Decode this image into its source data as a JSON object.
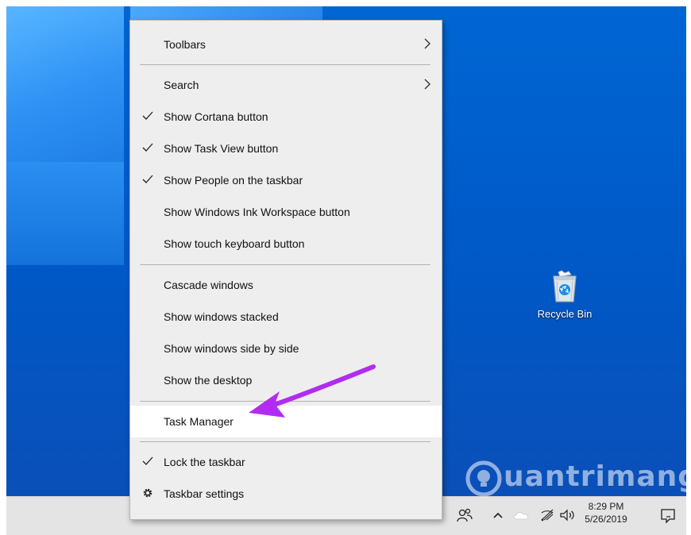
{
  "context_menu": {
    "items": [
      {
        "label": "Toolbars",
        "checked": false,
        "submenu": true
      },
      {
        "label": "Search",
        "checked": false,
        "submenu": true
      },
      {
        "label": "Show Cortana button",
        "checked": true
      },
      {
        "label": "Show Task View button",
        "checked": true
      },
      {
        "label": "Show People on the taskbar",
        "checked": true
      },
      {
        "label": "Show Windows Ink Workspace button",
        "checked": false
      },
      {
        "label": "Show touch keyboard button",
        "checked": false
      },
      {
        "label": "Cascade windows",
        "checked": false
      },
      {
        "label": "Show windows stacked",
        "checked": false
      },
      {
        "label": "Show windows side by side",
        "checked": false
      },
      {
        "label": "Show the desktop",
        "checked": false
      },
      {
        "label": "Task Manager",
        "checked": false,
        "highlighted": true
      },
      {
        "label": "Lock the taskbar",
        "checked": true
      },
      {
        "label": "Taskbar settings",
        "icon": "gear-icon"
      }
    ]
  },
  "desktop": {
    "recycle_bin_label": "Recycle Bin"
  },
  "taskbar": {
    "clock_time": "8:29 PM",
    "clock_date": "5/26/2019"
  },
  "watermark": {
    "text": "uantrimang"
  },
  "colors": {
    "desktop_blue": "#0058c6",
    "menu_bg": "#eeeeee",
    "annotation_arrow": "#b12cf0"
  }
}
